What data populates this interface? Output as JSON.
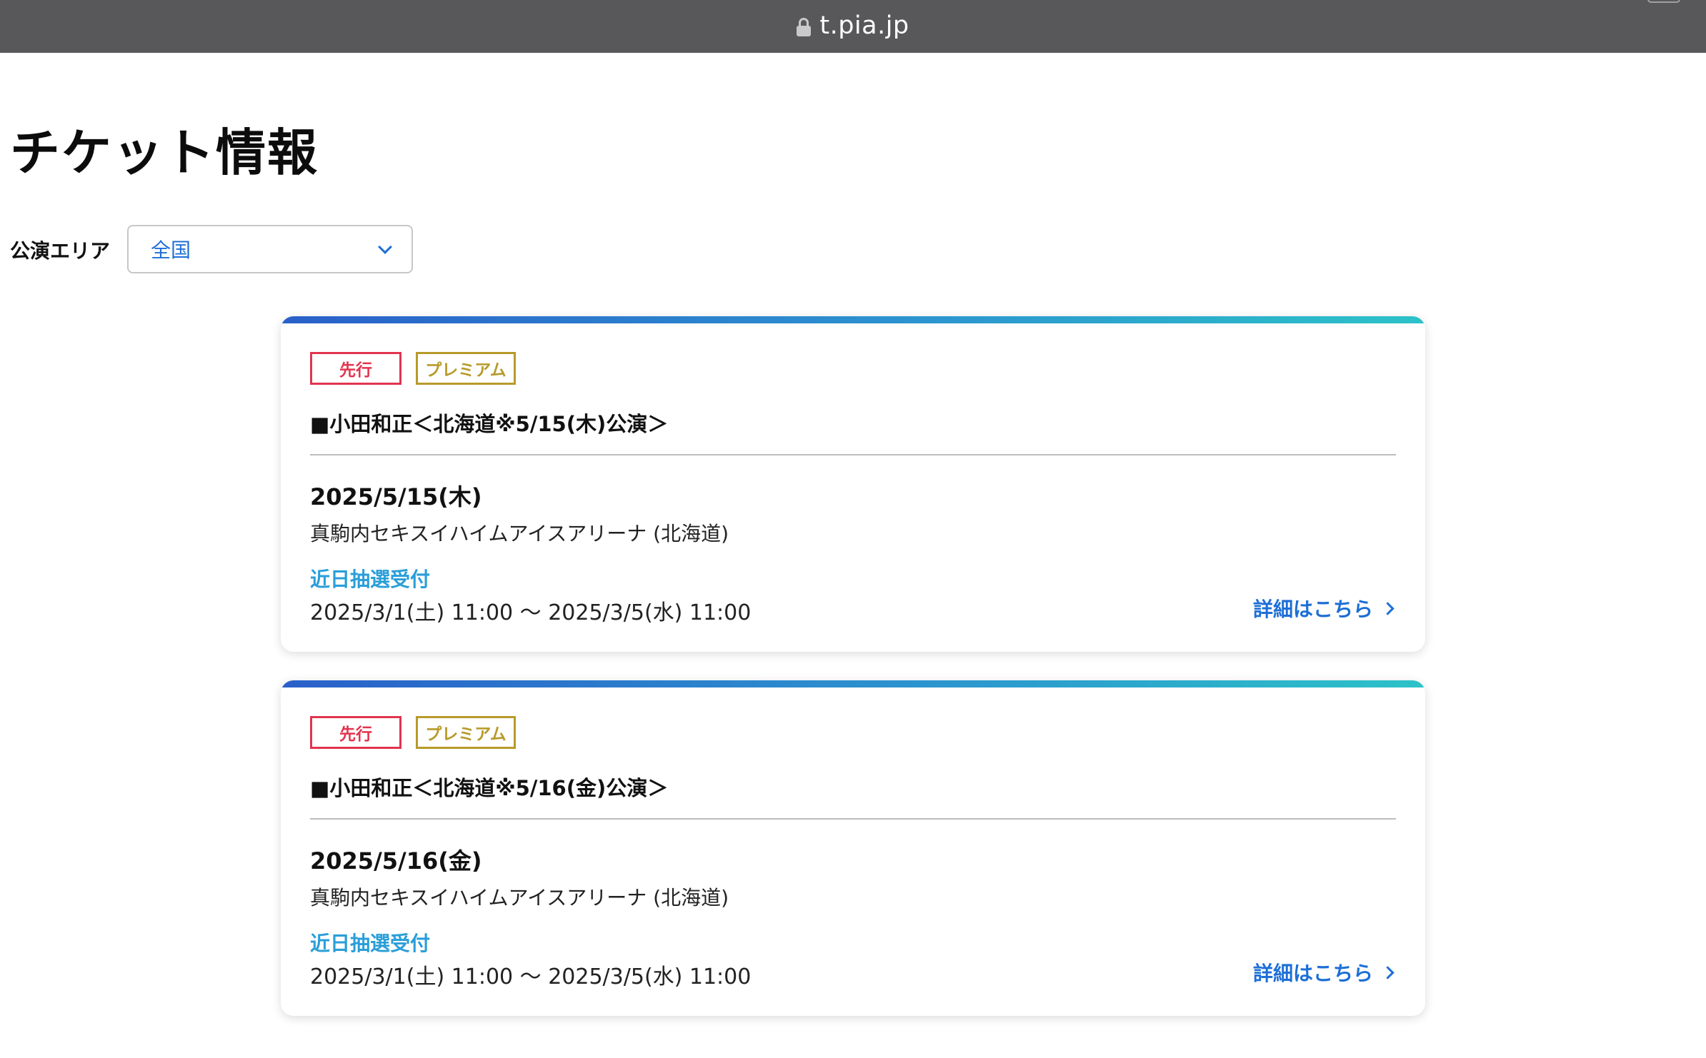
{
  "browser": {
    "url": "t.pia.jp"
  },
  "page": {
    "title": "チケット情報"
  },
  "filter": {
    "label": "公演エリア",
    "selected": "全国"
  },
  "events": [
    {
      "tags": [
        "先行",
        "プレミアム"
      ],
      "title": "■小田和正＜北海道※5/15(木)公演＞",
      "date": "2025/5/15(木)",
      "venue": "真駒内セキスイハイムアイスアリーナ (北海道)",
      "sale_type": "近日抽選受付",
      "sale_period": "2025/3/1(土) 11:00 〜 2025/3/5(水) 11:00",
      "detail_label": "詳細はこちら"
    },
    {
      "tags": [
        "先行",
        "プレミアム"
      ],
      "title": "■小田和正＜北海道※5/16(金)公演＞",
      "date": "2025/5/16(金)",
      "venue": "真駒内セキスイハイムアイスアリーナ (北海道)",
      "sale_type": "近日抽選受付",
      "sale_period": "2025/3/1(土) 11:00 〜 2025/3/5(水) 11:00",
      "detail_label": "詳細はこちら"
    }
  ],
  "colors": {
    "accent_link": "#1d6fd6",
    "sale_type": "#2a9ed8",
    "tag_sakou": "#e2344f",
    "tag_premium": "#b89a2a",
    "browser_bar": "#58585a"
  }
}
